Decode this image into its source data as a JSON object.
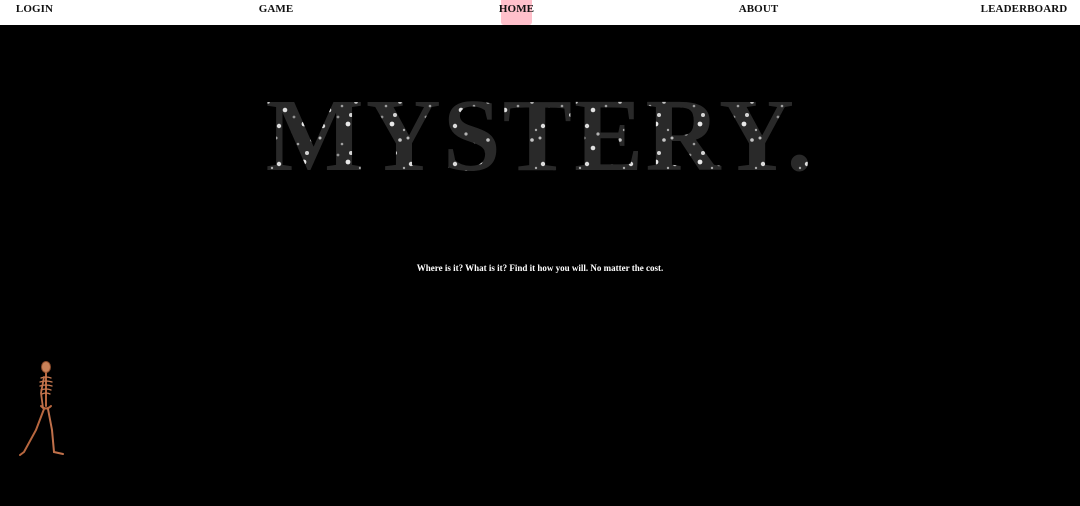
{
  "nav": {
    "login": "LOGIN",
    "game": "GAME",
    "home": "HOME",
    "about": "ABOUT",
    "leaderboard": "LEADERBOARD",
    "active_item": "HOME",
    "active_highlight_color": "#ffc0cb"
  },
  "hero": {
    "title": "MYSTERY."
  },
  "tagline": "Where is it? What is it? Find it how you will. No matter the cost.",
  "colors": {
    "background": "#000000",
    "navbar": "#ffffff",
    "tagline_text": "#ffffff"
  },
  "decorations": {
    "skeleton": "walking-skeleton-illustration"
  }
}
